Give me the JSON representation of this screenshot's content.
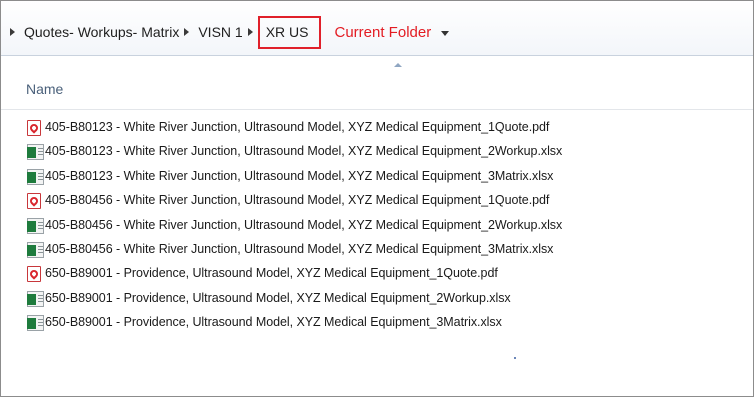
{
  "breadcrumb": {
    "items": [
      "Quotes- Workups- Matrix",
      "VISN 1",
      "XR US"
    ],
    "annotation": "Current Folder"
  },
  "columns": {
    "name": "Name"
  },
  "files": [
    {
      "name": "405-B80123 - White River Junction, Ultrasound Model, XYZ Medical Equipment_1Quote.pdf",
      "type": "pdf"
    },
    {
      "name": "405-B80123 - White River Junction, Ultrasound Model, XYZ Medical Equipment_2Workup.xlsx",
      "type": "xlsx"
    },
    {
      "name": "405-B80123 - White River Junction, Ultrasound Model, XYZ Medical Equipment_3Matrix.xlsx",
      "type": "xlsx"
    },
    {
      "name": "405-B80456 - White River Junction, Ultrasound Model, XYZ Medical Equipment_1Quote.pdf",
      "type": "pdf"
    },
    {
      "name": "405-B80456 - White River Junction, Ultrasound Model, XYZ Medical Equipment_2Workup.xlsx",
      "type": "xlsx"
    },
    {
      "name": "405-B80456 - White River Junction, Ultrasound Model, XYZ Medical Equipment_3Matrix.xlsx",
      "type": "xlsx"
    },
    {
      "name": "650-B89001 - Providence, Ultrasound Model, XYZ Medical Equipment_1Quote.pdf",
      "type": "pdf"
    },
    {
      "name": "650-B89001 - Providence, Ultrasound Model, XYZ Medical Equipment_2Workup.xlsx",
      "type": "xlsx"
    },
    {
      "name": "650-B89001 - Providence, Ultrasound Model, XYZ Medical Equipment_3Matrix.xlsx",
      "type": "xlsx"
    }
  ],
  "icons": {
    "pdf": "pdf-file-icon",
    "xlsx": "excel-file-icon"
  },
  "colors": {
    "annotation": "#e31c23",
    "highlight_border": "#e0202a"
  }
}
